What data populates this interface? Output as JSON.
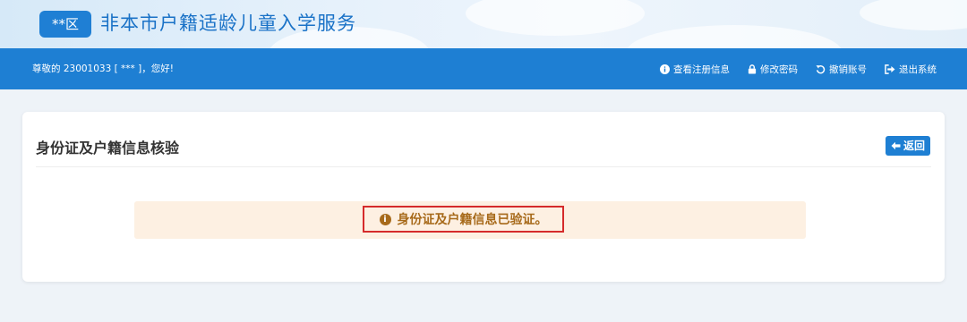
{
  "header": {
    "district_badge": "**区",
    "title": "非本市户籍适龄儿童入学服务"
  },
  "navbar": {
    "greeting": "尊敬的 23001033 [ *** ]，您好!",
    "actions": [
      {
        "label": "查看注册信息",
        "icon": "info-circle-icon"
      },
      {
        "label": "修改密码",
        "icon": "lock-icon"
      },
      {
        "label": "撤销账号",
        "icon": "undo-icon"
      },
      {
        "label": "退出系统",
        "icon": "sign-out-icon"
      }
    ]
  },
  "card": {
    "title": "身份证及户籍信息核验",
    "back_label": "返回",
    "back_icon": "arrow-left-icon",
    "alert": {
      "icon": "info-circle-icon",
      "message": "身份证及户籍信息已验证。"
    }
  },
  "colors": {
    "primary": "#1e7fd3",
    "alert_background": "#fdf0e2",
    "alert_text": "#a76a1a",
    "highlight_border": "#d52b2b"
  }
}
